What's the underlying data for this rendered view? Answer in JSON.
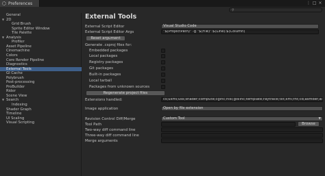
{
  "window": {
    "title": "Preferences",
    "menu": "⋮ □ ×"
  },
  "search": {
    "placeholder": ""
  },
  "sidebar": {
    "items": [
      {
        "label": "General",
        "indent": 0,
        "arrow": ""
      },
      {
        "label": "2D",
        "indent": 0,
        "arrow": "▼"
      },
      {
        "label": "Grid Brush",
        "indent": 2,
        "arrow": ""
      },
      {
        "label": "Sprite Editor Window",
        "indent": 2,
        "arrow": ""
      },
      {
        "label": "Tile Palette",
        "indent": 2,
        "arrow": ""
      },
      {
        "label": "Analysis",
        "indent": 0,
        "arrow": "▼"
      },
      {
        "label": "Profiler",
        "indent": 2,
        "arrow": ""
      },
      {
        "label": "Asset Pipeline",
        "indent": 0,
        "arrow": ""
      },
      {
        "label": "Cinemachine",
        "indent": 0,
        "arrow": ""
      },
      {
        "label": "Colors",
        "indent": 0,
        "arrow": ""
      },
      {
        "label": "Core Render Pipeline",
        "indent": 0,
        "arrow": ""
      },
      {
        "label": "Diagnostics",
        "indent": 0,
        "arrow": ""
      },
      {
        "label": "External Tools",
        "indent": 0,
        "arrow": "",
        "selected": true
      },
      {
        "label": "GI Cache",
        "indent": 0,
        "arrow": ""
      },
      {
        "label": "Polybrush",
        "indent": 0,
        "arrow": ""
      },
      {
        "label": "Post-processing",
        "indent": 0,
        "arrow": ""
      },
      {
        "label": "ProBuilder",
        "indent": 0,
        "arrow": ""
      },
      {
        "label": "Rider",
        "indent": 0,
        "arrow": ""
      },
      {
        "label": "Scene View",
        "indent": 0,
        "arrow": ""
      },
      {
        "label": "Search",
        "indent": 0,
        "arrow": "▼"
      },
      {
        "label": "Indexing",
        "indent": 2,
        "arrow": ""
      },
      {
        "label": "Shader Graph",
        "indent": 0,
        "arrow": ""
      },
      {
        "label": "Timeline",
        "indent": 0,
        "arrow": ""
      },
      {
        "label": "UI Scaling",
        "indent": 0,
        "arrow": ""
      },
      {
        "label": "Visual Scripting",
        "indent": 0,
        "arrow": ""
      }
    ]
  },
  "main": {
    "title": "External Tools",
    "script_editor_label": "External Script Editor",
    "script_editor_value": "Visual Studio Code",
    "script_editor_args_label": "External Script Editor Args",
    "script_editor_args_value": "\"$(ProjectPath)\" -g \"$(File)\":$(Line):$(Column)",
    "reset_argument": "Reset argument",
    "generate_label": "Generate .csproj files for:",
    "packages": [
      "Embedded packages",
      "Local packages",
      "Registry packages",
      "Git packages",
      "Built-in packages",
      "Local tarball",
      "Packages from unknown sources"
    ],
    "regenerate": "Regenerate project files",
    "extensions_label": "Extensions handled:",
    "extensions_value": "cs;uxml;uss;shader;compute;cginc;hlsl;glslinc;template;raytrace;txt;xml;fnt;cd;asmdef;asmref;js",
    "image_app_label": "Image application",
    "image_app_value": "Open by file extension",
    "revision_label": "Revision Control Diff/Merge",
    "revision_value": "Custom Tool",
    "tool_path_label": "Tool Path",
    "browse": "Browse",
    "two_way_label": "Two-way diff command line",
    "three_way_label": "Three-way diff command line",
    "merge_label": "Merge arguments"
  }
}
